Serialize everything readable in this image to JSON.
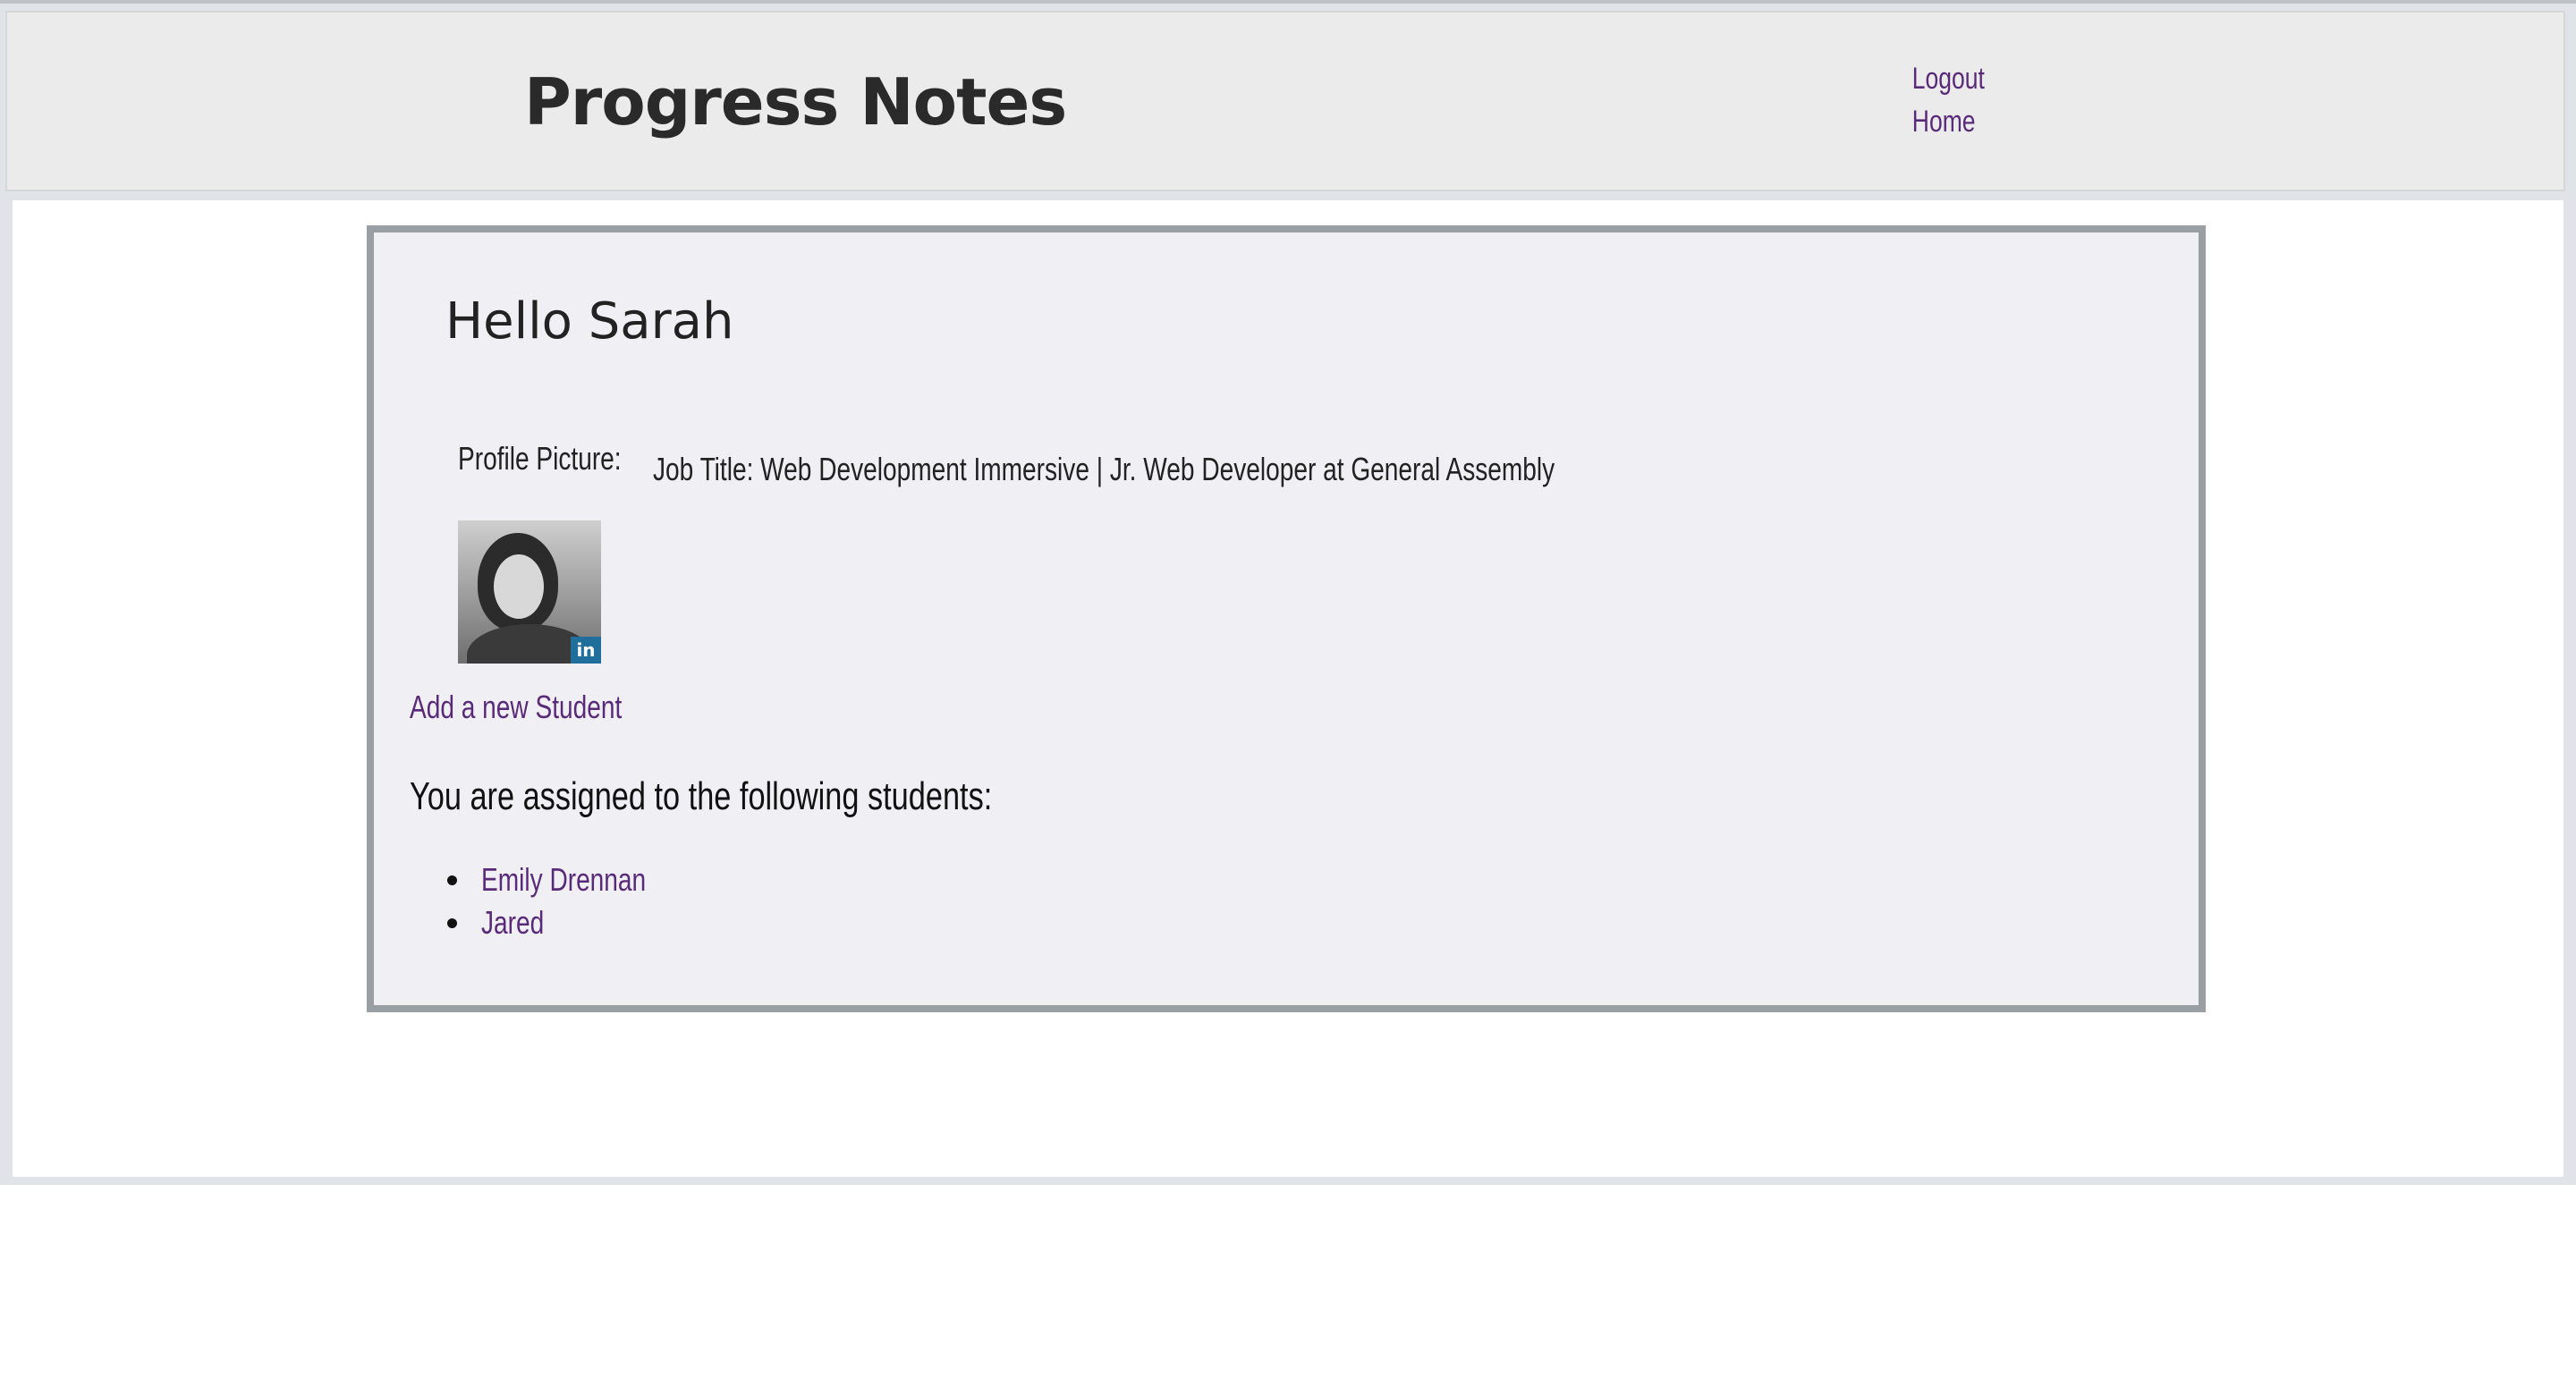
{
  "header": {
    "title": "Progress Notes",
    "nav": {
      "logout_label": "Logout",
      "home_label": "Home"
    }
  },
  "profile": {
    "greeting": "Hello Sarah",
    "picture_label": "Profile Picture:",
    "job_title": "Job Title: Web Development Immersive | Jr. Web Developer at General Assembly",
    "avatar_badge": "in"
  },
  "actions": {
    "add_student_label": "Add a new Student"
  },
  "students": {
    "heading": "You are assigned to the following students:",
    "items": [
      {
        "name": "Emily Drennan"
      },
      {
        "name": "Jared"
      }
    ]
  },
  "colors": {
    "link": "#5a2a7a",
    "header_bg": "#ebebeb",
    "card_bg": "#f0f0f4",
    "card_border": "#9a9fa4",
    "linkedin": "#1f6e9c"
  },
  "icons": {
    "avatar_badge": "linkedin-icon"
  }
}
